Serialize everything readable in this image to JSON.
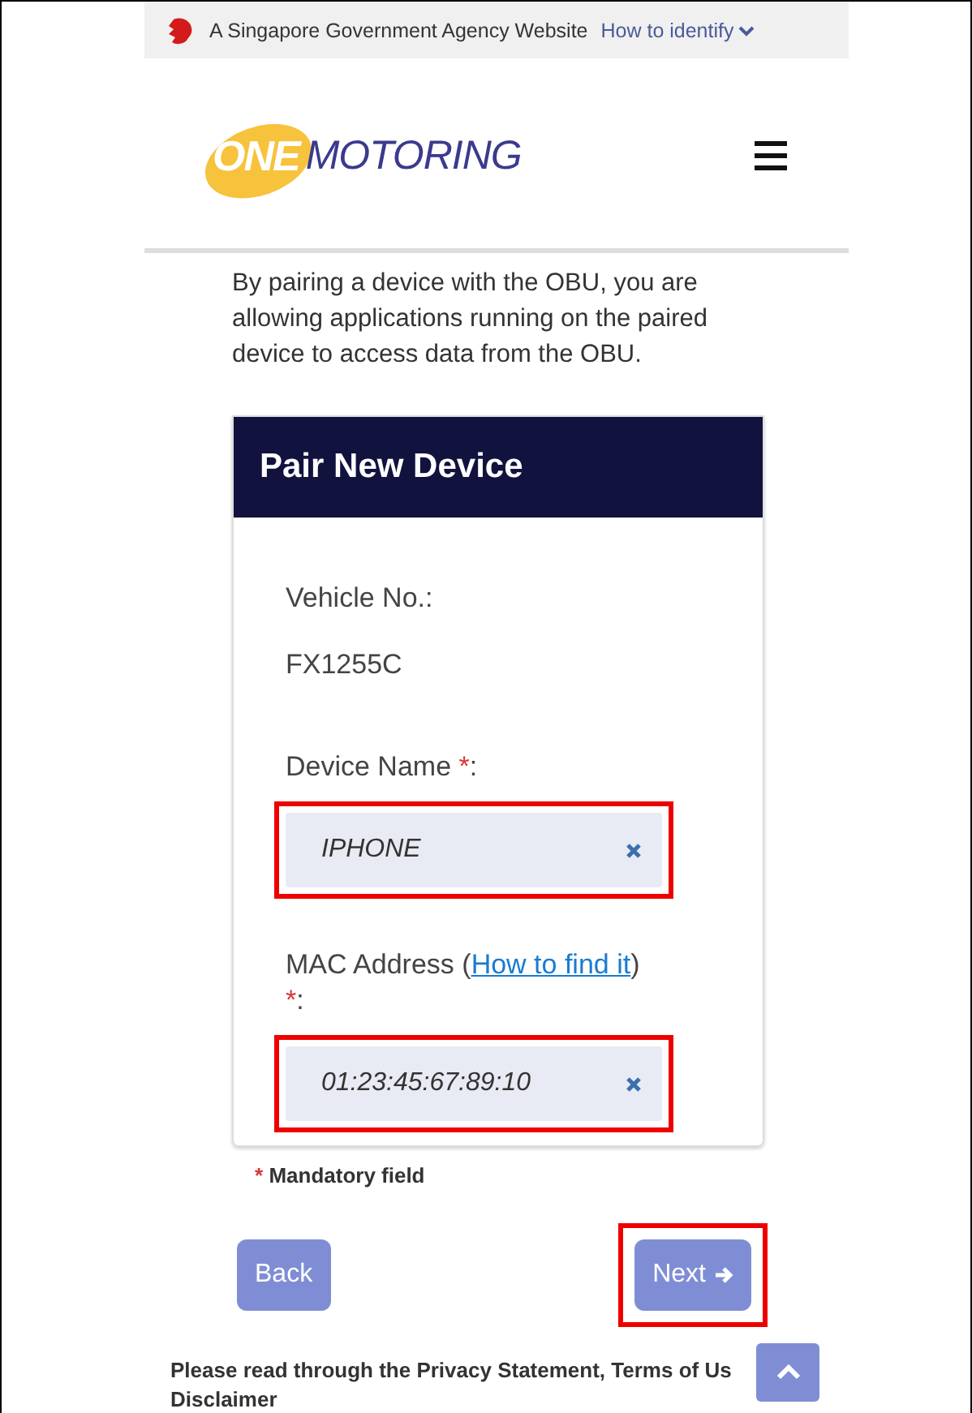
{
  "gov_banner": {
    "text": "A Singapore Government Agency Website",
    "link": "How to identify"
  },
  "header": {
    "logo_accent": "ONE",
    "logo_text": "MOTORING"
  },
  "intro": "By pairing a device with the OBU, you are allowing applications running on the paired device to access data from the OBU.",
  "form": {
    "title": "Pair New Device",
    "vehicle": {
      "label": "Vehicle No.:",
      "value": "FX1255C"
    },
    "fields": [
      {
        "label": "Device Name",
        "required_mark": "*",
        "colon": ":",
        "value": "IPHONE",
        "highlighted": true
      },
      {
        "label": "MAC Address (",
        "link": "How to find it",
        "after": ")",
        "required_mark": "*",
        "colon": ":",
        "value": "01:23:45:67:89:10",
        "highlighted": true
      }
    ]
  },
  "mandatory_note": {
    "mark": "*",
    "text": "Mandatory field"
  },
  "buttons": [
    {
      "label": "Back",
      "kind": "back",
      "highlighted": false
    },
    {
      "label": "Next",
      "kind": "next",
      "highlighted": true
    }
  ],
  "footer_text": "Please read through the Privacy Statement, Terms of Us",
  "footer_text_2": "Disclaimer"
}
